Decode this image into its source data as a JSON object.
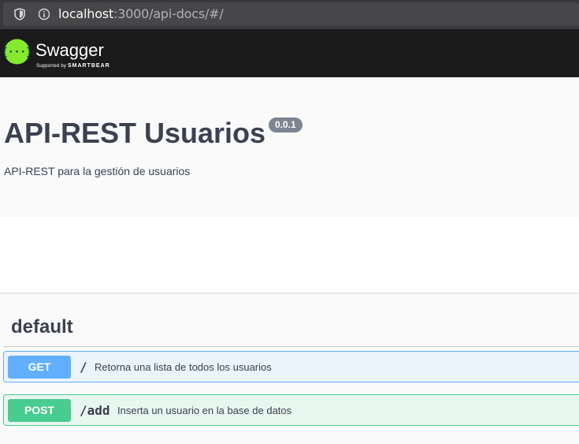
{
  "browser": {
    "url_host": "localhost",
    "url_rest": ":3000/api-docs/#/"
  },
  "topbar": {
    "logo_text": "Swagger",
    "logo_sub_prefix": "Supported by",
    "logo_sub_brand": "SMARTBEAR"
  },
  "info": {
    "title": "API-REST Usuarios",
    "version": "0.0.1",
    "description": "API-REST para la gestión de usuarios"
  },
  "tag": {
    "name": "default"
  },
  "operations": [
    {
      "method": "GET",
      "path": "/",
      "summary": "Retorna una lista de todos los usuarios"
    },
    {
      "method": "POST",
      "path": "/add",
      "summary": "Inserta un usuario en la base de datos"
    }
  ],
  "colors": {
    "get": "#61affe",
    "post": "#49cc90",
    "topbar": "#1b1b1b",
    "logo": "#85ea2d"
  },
  "icons": [
    "shield-icon",
    "info-icon",
    "swagger-logo-icon"
  ]
}
